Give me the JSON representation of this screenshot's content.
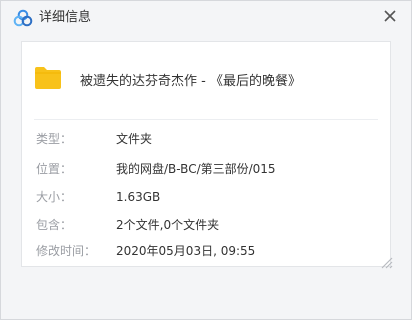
{
  "dialog": {
    "title": "详细信息",
    "file_name": "被遗失的达芬奇杰作 - 《最后的晚餐》",
    "details": [
      {
        "label": "类型：",
        "value": "文件夹"
      },
      {
        "label": "位置：",
        "value": "我的网盘/B-BC/第三部份/015"
      },
      {
        "label": "大小：",
        "value": "1.63GB"
      },
      {
        "label": "包含：",
        "value": "2个文件,0个文件夹"
      },
      {
        "label": "修改时间：",
        "value": "2020年05月03日, 09:55"
      }
    ]
  },
  "icons": {
    "app_logo": "cloud-rings-logo",
    "close": "close-icon",
    "folder": "folder-icon",
    "grip": "resize-grip-icon"
  },
  "colors": {
    "folder": "#f8c21a",
    "label": "#9a9da3",
    "text": "#333333",
    "logo_blue": "#3a8ee6"
  }
}
